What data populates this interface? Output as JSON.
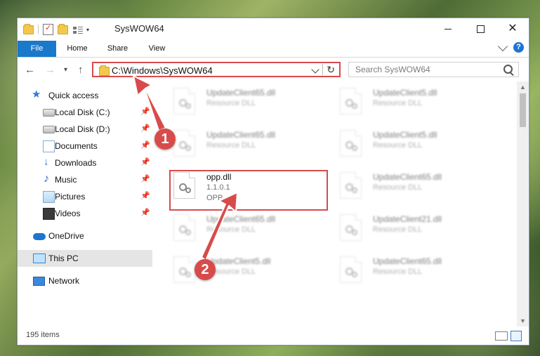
{
  "window": {
    "title": "SysWOW64"
  },
  "ribbon": {
    "tabs": [
      "File",
      "Home",
      "Share",
      "View"
    ]
  },
  "navigation": {
    "address": "C:\\Windows\\SysWOW64",
    "search_placeholder": "Search SysWOW64"
  },
  "sidebar": {
    "items": [
      {
        "label": "Quick access"
      },
      {
        "label": "Local Disk (C:)"
      },
      {
        "label": "Local Disk (D:)"
      },
      {
        "label": "Documents"
      },
      {
        "label": "Downloads"
      },
      {
        "label": "Music"
      },
      {
        "label": "Pictures"
      },
      {
        "label": "Videos"
      },
      {
        "label": "OneDrive"
      },
      {
        "label": "This PC"
      },
      {
        "label": "Network"
      }
    ]
  },
  "files": [
    {
      "name": "UpdateClient65.dll",
      "type": "Resource DLL"
    },
    {
      "name": "UpdateClient5.dll",
      "type": "Resource DLL"
    },
    {
      "name": "UpdateClient65.dll",
      "type": "Resource DLL"
    },
    {
      "name": "UpdateClient5.dll",
      "type": "Resource DLL"
    },
    {
      "name": "opp.dll",
      "version": "1.1.0.1",
      "type": "OPP"
    },
    {
      "name": "UpdateClient65.dll",
      "type": "Resource DLL"
    },
    {
      "name": "UpdateClient65.dll",
      "type": "Resource DLL"
    },
    {
      "name": "UpdateClient21.dll",
      "type": "Resource DLL"
    },
    {
      "name": "UpdateClient5.dll",
      "type": "Resource DLL"
    },
    {
      "name": "UpdateClient65.dll",
      "type": "Resource DLL"
    }
  ],
  "callouts": [
    "1",
    "2"
  ],
  "status": {
    "items_count": "195 items"
  },
  "colors": {
    "highlight": "#d84b4b",
    "file_tab": "#1979ca"
  }
}
